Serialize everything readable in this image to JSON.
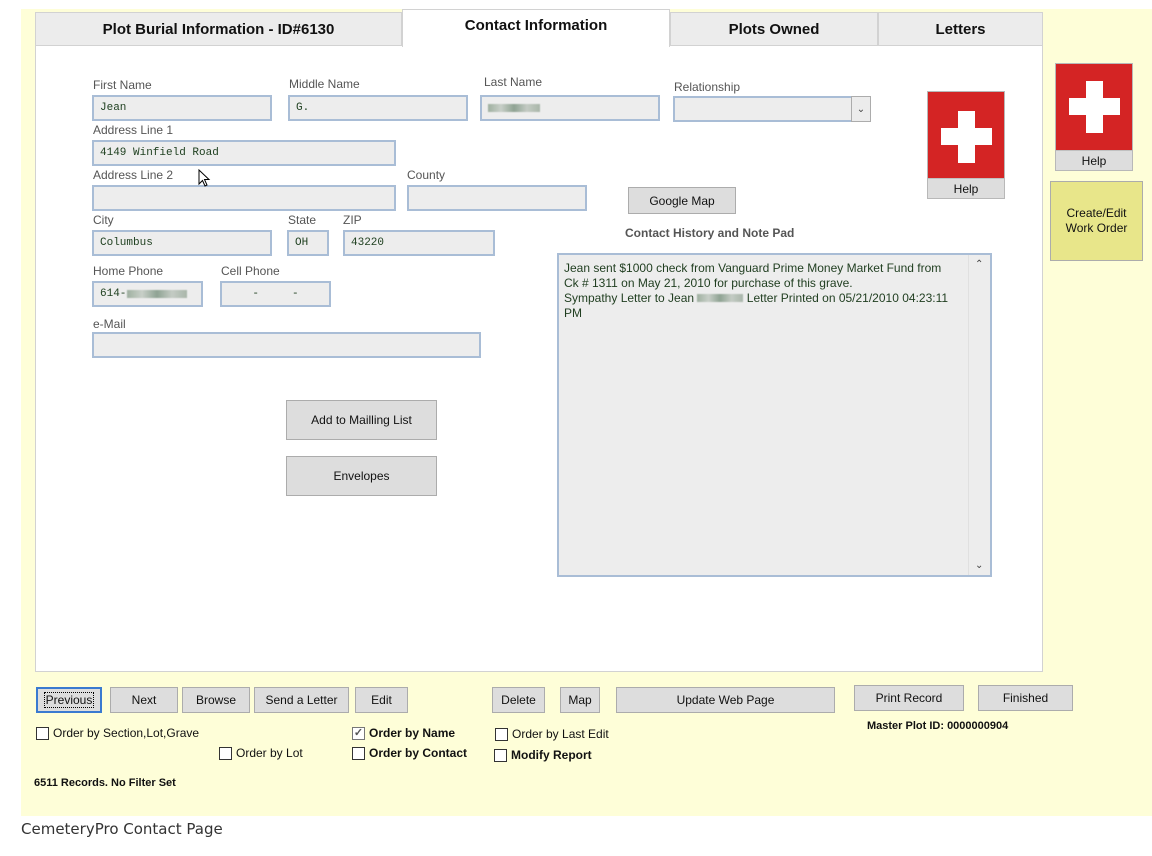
{
  "tabs": [
    {
      "label": "Plot Burial Information - ID#6130",
      "active": false
    },
    {
      "label": "Contact Information",
      "active": true
    },
    {
      "label": "Plots Owned",
      "active": false
    },
    {
      "label": "Letters",
      "active": false
    }
  ],
  "form": {
    "first_name": {
      "label": "First Name",
      "value": "Jean"
    },
    "middle_name": {
      "label": "Middle Name",
      "value": "G."
    },
    "last_name": {
      "label": "Last Name",
      "value": "[redacted]"
    },
    "relationship": {
      "label": "Relationship",
      "value": ""
    },
    "address1": {
      "label": "Address Line 1",
      "value": "4149 Winfield Road"
    },
    "address2": {
      "label": "Address Line 2",
      "value": ""
    },
    "county": {
      "label": "County",
      "value": ""
    },
    "city": {
      "label": "City",
      "value": "Columbus"
    },
    "state": {
      "label": "State",
      "value": "OH"
    },
    "zip": {
      "label": "ZIP",
      "value": "43220"
    },
    "home_phone": {
      "label": "Home Phone",
      "value": "614-"
    },
    "cell_phone": {
      "label": "Cell Phone",
      "value": "-     -"
    },
    "email": {
      "label": "e-Mail",
      "value": ""
    }
  },
  "buttons": {
    "google_map": "Google Map",
    "add_mailing": "Add to Mailling List",
    "envelopes": "Envelopes",
    "help_inner": "Help",
    "help_outer": "Help",
    "work_order": "Create/Edit Work Order"
  },
  "notes": {
    "title": "Contact History and Note Pad",
    "line1": "Jean sent $1000 check from Vanguard Prime Money Market Fund from Ck # 1311 on May 21, 2010 for purchase of this grave.",
    "line2_prefix": "Sympathy Letter to Jean",
    "line2_suffix": "Letter Printed on 05/21/2010 04:23:11 PM"
  },
  "toolbar": {
    "previous": "Previous",
    "next": "Next",
    "browse": "Browse",
    "send_letter": "Send a Letter",
    "edit": "Edit",
    "delete": "Delete",
    "map": "Map",
    "update_web": "Update Web Page",
    "print_record": "Print Record",
    "finished": "Finished"
  },
  "options": {
    "order_section": {
      "label": "Order by Section,Lot,Grave",
      "checked": false
    },
    "order_lot": {
      "label": "Order by Lot",
      "checked": false
    },
    "order_name": {
      "label": "Order by Name",
      "checked": true
    },
    "order_contact": {
      "label": "Order by Contact",
      "checked": false
    },
    "order_last_edit": {
      "label": "Order by Last Edit",
      "checked": false
    },
    "modify_report": {
      "label": "Modify Report",
      "checked": false
    }
  },
  "status": {
    "records": "6511 Records. No Filter Set",
    "master_plot": "Master Plot ID: 0000000904"
  },
  "caption": "CemeteryPro Contact Page",
  "colors": {
    "app_background": "#fefed8",
    "help_red": "#d42424",
    "work_order_bg": "#e8e68a",
    "field_border": "#a9bdd6"
  }
}
